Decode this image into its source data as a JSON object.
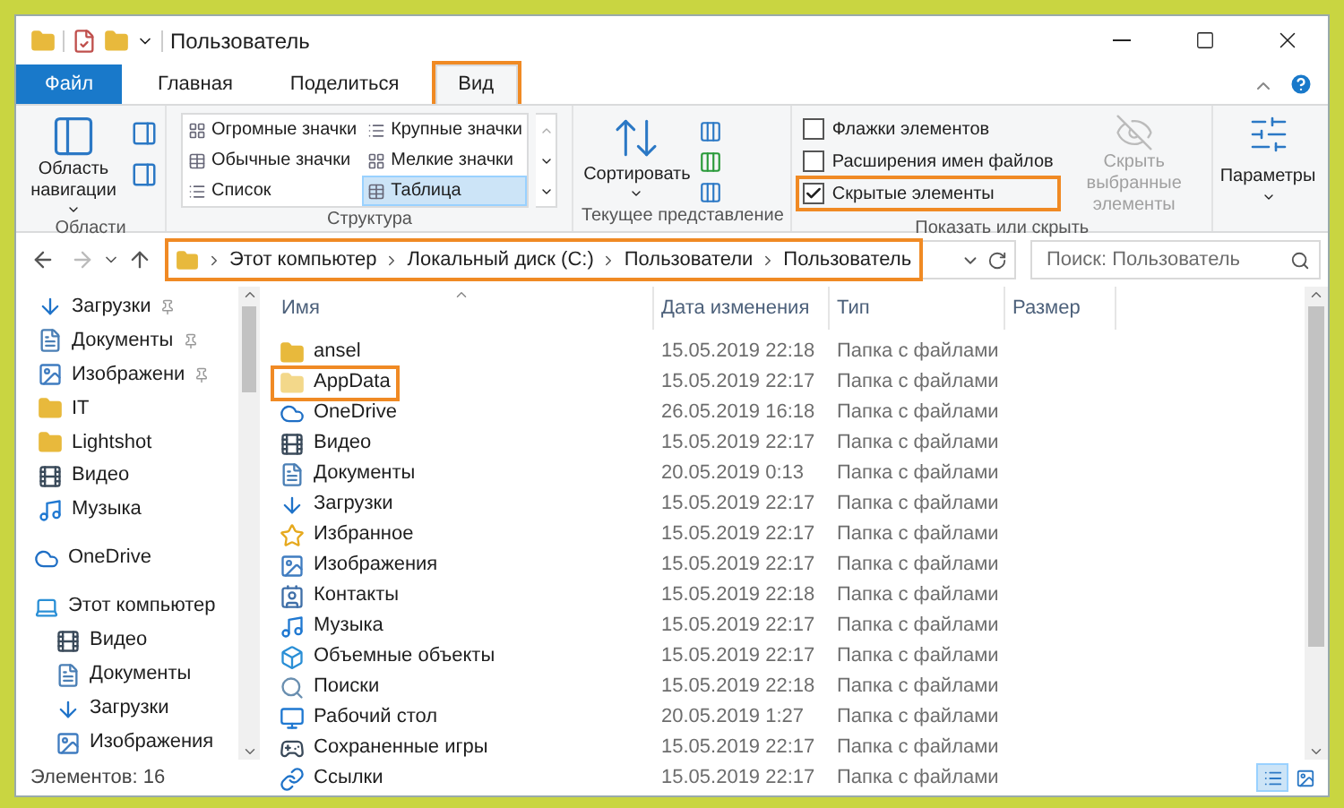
{
  "window": {
    "title": "Пользователь"
  },
  "tabs": [
    {
      "label": "Файл",
      "kind": "file",
      "selected": false,
      "highlighted": false
    },
    {
      "label": "Главная",
      "kind": "tab",
      "selected": false,
      "highlighted": false
    },
    {
      "label": "Поделиться",
      "kind": "tab",
      "selected": false,
      "highlighted": false
    },
    {
      "label": "Вид",
      "kind": "tab",
      "selected": true,
      "highlighted": true
    }
  ],
  "ribbon": {
    "areas": {
      "label": "Области",
      "nav_pane": "Область навигации"
    },
    "layout": {
      "label": "Структура",
      "options": [
        {
          "label": "Огромные значки",
          "selected": false
        },
        {
          "label": "Крупные значки",
          "selected": false
        },
        {
          "label": "Обычные значки",
          "selected": false
        },
        {
          "label": "Мелкие значки",
          "selected": false
        },
        {
          "label": "Список",
          "selected": false
        },
        {
          "label": "Таблица",
          "selected": true
        }
      ]
    },
    "current_view": {
      "label": "Текущее представление",
      "sort": "Сортировать"
    },
    "show_hide": {
      "label": "Показать или скрыть",
      "options": [
        {
          "label": "Флажки элементов",
          "checked": false,
          "highlighted": false
        },
        {
          "label": "Расширения имен файлов",
          "checked": false,
          "highlighted": false
        },
        {
          "label": "Скрытые элементы",
          "checked": true,
          "highlighted": true
        }
      ],
      "hide_selected": {
        "label": "Скрыть выбранные элементы",
        "disabled": true
      }
    },
    "options": "Параметры"
  },
  "address": {
    "breadcrumb": [
      "Этот компьютер",
      "Локальный диск (C:)",
      "Пользователи",
      "Пользователь"
    ],
    "highlighted": true,
    "search_placeholder": "Поиск: Пользователь"
  },
  "sidebar": {
    "items": [
      {
        "label": "Загрузки",
        "kind": "download",
        "pinned": true
      },
      {
        "label": "Документы",
        "kind": "document",
        "pinned": true
      },
      {
        "label": "Изображени",
        "kind": "image",
        "pinned": true
      },
      {
        "label": "IT",
        "kind": "folder",
        "pinned": false
      },
      {
        "label": "Lightshot",
        "kind": "folder",
        "pinned": false
      },
      {
        "label": "Видео",
        "kind": "video",
        "pinned": false
      },
      {
        "label": "Музыка",
        "kind": "music",
        "pinned": false
      }
    ],
    "sections": [
      {
        "label": "OneDrive",
        "kind": "cloud"
      },
      {
        "label": "Этот компьютер",
        "kind": "computer",
        "children": [
          {
            "label": "Видео",
            "kind": "video"
          },
          {
            "label": "Документы",
            "kind": "document"
          },
          {
            "label": "Загрузки",
            "kind": "download"
          },
          {
            "label": "Изображения",
            "kind": "image"
          }
        ]
      }
    ]
  },
  "table": {
    "columns": [
      "Имя",
      "Дата изменения",
      "Тип",
      "Размер"
    ],
    "rows": [
      {
        "name": "ansel",
        "kind": "folder",
        "date": "15.05.2019 22:18",
        "type": "Папка с файлами",
        "highlighted": false
      },
      {
        "name": "AppData",
        "kind": "folder-light",
        "date": "15.05.2019 22:17",
        "type": "Папка с файлами",
        "highlighted": true
      },
      {
        "name": "OneDrive",
        "kind": "cloud",
        "date": "26.05.2019 16:18",
        "type": "Папка с файлами",
        "highlighted": false
      },
      {
        "name": "Видео",
        "kind": "video",
        "date": "15.05.2019 22:17",
        "type": "Папка с файлами",
        "highlighted": false
      },
      {
        "name": "Документы",
        "kind": "document",
        "date": "20.05.2019 0:13",
        "type": "Папка с файлами",
        "highlighted": false
      },
      {
        "name": "Загрузки",
        "kind": "download",
        "date": "15.05.2019 22:17",
        "type": "Папка с файлами",
        "highlighted": false
      },
      {
        "name": "Избранное",
        "kind": "star",
        "date": "15.05.2019 22:17",
        "type": "Папка с файлами",
        "highlighted": false
      },
      {
        "name": "Изображения",
        "kind": "image",
        "date": "15.05.2019 22:17",
        "type": "Папка с файлами",
        "highlighted": false
      },
      {
        "name": "Контакты",
        "kind": "contact",
        "date": "15.05.2019 22:18",
        "type": "Папка с файлами",
        "highlighted": false
      },
      {
        "name": "Музыка",
        "kind": "music",
        "date": "15.05.2019 22:17",
        "type": "Папка с файлами",
        "highlighted": false
      },
      {
        "name": "Объемные объекты",
        "kind": "cube",
        "date": "15.05.2019 22:17",
        "type": "Папка с файлами",
        "highlighted": false
      },
      {
        "name": "Поиски",
        "kind": "search",
        "date": "15.05.2019 22:18",
        "type": "Папка с файлами",
        "highlighted": false
      },
      {
        "name": "Рабочий стол",
        "kind": "desktop",
        "date": "20.05.2019 1:27",
        "type": "Папка с файлами",
        "highlighted": false
      },
      {
        "name": "Сохраненные игры",
        "kind": "game",
        "date": "15.05.2019 22:17",
        "type": "Папка с файлами",
        "highlighted": false
      },
      {
        "name": "Ссылки",
        "kind": "link",
        "date": "15.05.2019 22:17",
        "type": "Папка с файлами",
        "highlighted": false
      }
    ]
  },
  "status_bar": {
    "count": "Элементов: 16",
    "views": [
      {
        "kind": "details",
        "selected": true
      },
      {
        "kind": "large",
        "selected": false
      }
    ]
  }
}
